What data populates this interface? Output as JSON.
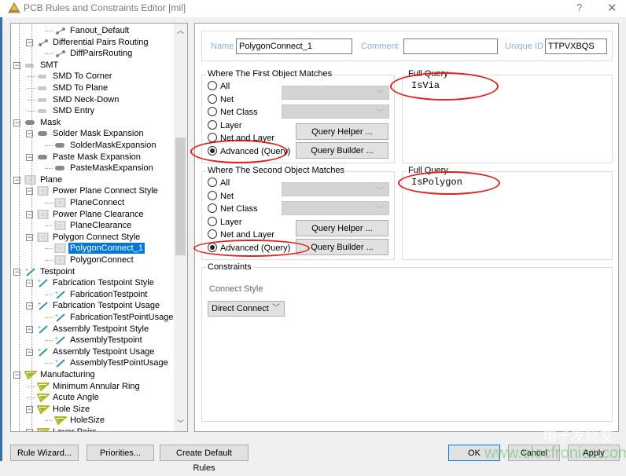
{
  "window": {
    "title": "PCB Rules and Constraints Editor [mil]",
    "help_label": "?",
    "close_label": "✕"
  },
  "tree": {
    "items": [
      {
        "label": "Fanout_Default",
        "level": 3,
        "icon": "routing-icon"
      },
      {
        "label": "Differential Pairs Routing",
        "level": 2,
        "icon": "routing-icon",
        "expanded": true
      },
      {
        "label": "DiffPairsRouting",
        "level": 3,
        "icon": "routing-icon"
      },
      {
        "label": "SMT",
        "level": 1,
        "icon": "smt-icon",
        "expanded": true
      },
      {
        "label": "SMD To Corner",
        "level": 2,
        "icon": "smt-icon"
      },
      {
        "label": "SMD To Plane",
        "level": 2,
        "icon": "smt-icon"
      },
      {
        "label": "SMD Neck-Down",
        "level": 2,
        "icon": "smt-icon"
      },
      {
        "label": "SMD Entry",
        "level": 2,
        "icon": "smt-icon"
      },
      {
        "label": "Mask",
        "level": 1,
        "icon": "mask-icon",
        "expanded": true
      },
      {
        "label": "Solder Mask Expansion",
        "level": 2,
        "icon": "mask-icon",
        "expanded": true
      },
      {
        "label": "SolderMaskExpansion",
        "level": 3,
        "icon": "mask-icon"
      },
      {
        "label": "Paste Mask Expansion",
        "level": 2,
        "icon": "mask-icon",
        "expanded": true
      },
      {
        "label": "PasteMaskExpansion",
        "level": 3,
        "icon": "mask-icon"
      },
      {
        "label": "Plane",
        "level": 1,
        "icon": "plane-icon",
        "expanded": true
      },
      {
        "label": "Power Plane Connect Style",
        "level": 2,
        "icon": "plane-icon",
        "expanded": true
      },
      {
        "label": "PlaneConnect",
        "level": 3,
        "icon": "plane-icon"
      },
      {
        "label": "Power Plane Clearance",
        "level": 2,
        "icon": "plane-icon",
        "expanded": true
      },
      {
        "label": "PlaneClearance",
        "level": 3,
        "icon": "plane-icon"
      },
      {
        "label": "Polygon Connect Style",
        "level": 2,
        "icon": "plane-icon",
        "expanded": true
      },
      {
        "label": "PolygonConnect_1",
        "level": 3,
        "icon": "plane-icon",
        "selected": true
      },
      {
        "label": "PolygonConnect",
        "level": 3,
        "icon": "plane-icon"
      },
      {
        "label": "Testpoint",
        "level": 1,
        "icon": "testpoint-icon",
        "expanded": true
      },
      {
        "label": "Fabrication Testpoint Style",
        "level": 2,
        "icon": "testpoint-icon",
        "expanded": true
      },
      {
        "label": "FabricationTestpoint",
        "level": 3,
        "icon": "testpoint-icon"
      },
      {
        "label": "Fabrication Testpoint Usage",
        "level": 2,
        "icon": "testpoint-icon",
        "expanded": true
      },
      {
        "label": "FabricationTestPointUsage",
        "level": 3,
        "icon": "testpoint-icon"
      },
      {
        "label": "Assembly Testpoint Style",
        "level": 2,
        "icon": "testpoint-icon",
        "expanded": true
      },
      {
        "label": "AssemblyTestpoint",
        "level": 3,
        "icon": "testpoint-icon"
      },
      {
        "label": "Assembly Testpoint Usage",
        "level": 2,
        "icon": "testpoint-icon",
        "expanded": true
      },
      {
        "label": "AssemblyTestPointUsage",
        "level": 3,
        "icon": "testpoint-icon"
      },
      {
        "label": "Manufacturing",
        "level": 1,
        "icon": "manufacturing-icon",
        "expanded": true
      },
      {
        "label": "Minimum Annular Ring",
        "level": 2,
        "icon": "manufacturing-icon"
      },
      {
        "label": "Acute Angle",
        "level": 2,
        "icon": "manufacturing-icon"
      },
      {
        "label": "Hole Size",
        "level": 2,
        "icon": "manufacturing-icon",
        "expanded": true
      },
      {
        "label": "HoleSize",
        "level": 3,
        "icon": "manufacturing-icon"
      },
      {
        "label": "Layer Pairs",
        "level": 2,
        "icon": "manufacturing-icon",
        "expanded": true
      }
    ]
  },
  "rule": {
    "name_label": "Name",
    "name_value": "PolygonConnect_1",
    "comment_label": "Comment",
    "comment_value": "",
    "uid_label": "Unique ID",
    "uid_value": "TTPVXBQS"
  },
  "first_match": {
    "title": "Where The First Object Matches",
    "options": [
      "All",
      "Net",
      "Net Class",
      "Layer",
      "Net and Layer",
      "Advanced (Query)"
    ],
    "selected": "Advanced (Query)",
    "query_helper": "Query Helper ...",
    "query_builder": "Query Builder ...",
    "full_query_label": "Full Query",
    "full_query": "IsVia"
  },
  "second_match": {
    "title": "Where The Second Object Matches",
    "options": [
      "All",
      "Net",
      "Net Class",
      "Layer",
      "Net and Layer",
      "Advanced (Query)"
    ],
    "selected": "Advanced (Query)",
    "query_helper": "Query Helper ...",
    "query_builder": "Query Builder ...",
    "full_query_label": "Full Query",
    "full_query": "IsPolygon"
  },
  "constraints": {
    "title": "Constraints",
    "connect_style_label": "Connect Style",
    "connect_style_value": "Direct Connect"
  },
  "footer": {
    "rule_wizard": "Rule Wizard...",
    "priorities": "Priorities...",
    "create_default": "Create Default Rules",
    "ok": "OK",
    "cancel": "Cancel",
    "apply": "Apply"
  },
  "watermark": {
    "text_cn": "电子发烧友",
    "url": "www.elecfans.com",
    "overlay": "www.elecfronics.com"
  },
  "colors": {
    "selection": "#0078d7",
    "annotation": "#e02020",
    "field_label": "#8fb0d3"
  }
}
